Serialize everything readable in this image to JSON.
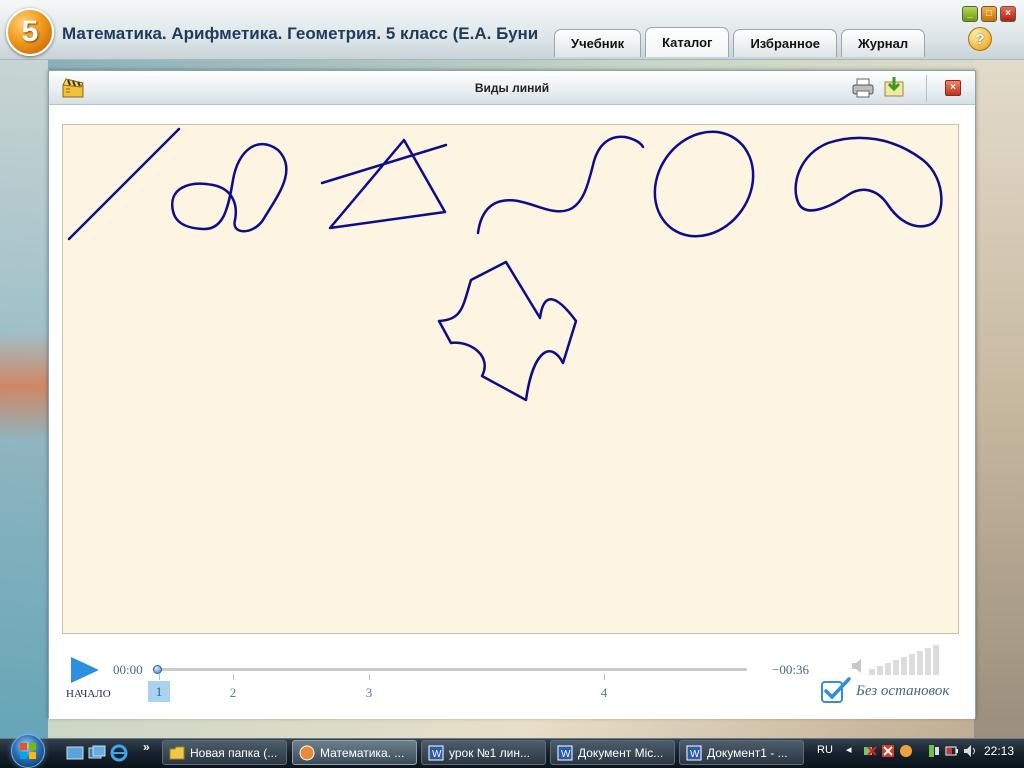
{
  "header": {
    "grade": "5",
    "title": "Математика. Арифметика. Геометрия. 5 класс (Е.А. Буни",
    "tabs": [
      {
        "label": "Учебник",
        "active": false
      },
      {
        "label": "Каталог",
        "active": true
      },
      {
        "label": "Избранное",
        "active": false
      },
      {
        "label": "Журнал",
        "active": false
      }
    ],
    "help": "?"
  },
  "content": {
    "title": "Виды линий"
  },
  "player": {
    "start_label": "НАЧАЛО",
    "time_current": "00:00",
    "time_remaining": "−00:36",
    "progress": 0,
    "markers": [
      "1",
      "2",
      "3",
      "4"
    ],
    "active_marker": "1",
    "nonstop_label": "Без остановок",
    "nonstop_checked": true
  },
  "taskbar": {
    "items": [
      {
        "label": "Новая папка (...",
        "icon": "folder-icon",
        "active": false
      },
      {
        "label": "Математика. ...",
        "icon": "app-icon",
        "active": true
      },
      {
        "label": "урок №1 лин...",
        "icon": "word-icon",
        "active": false
      },
      {
        "label": "Документ Mic...",
        "icon": "word-icon",
        "active": false
      },
      {
        "label": "Документ1 - ...",
        "icon": "word-icon",
        "active": false
      }
    ],
    "language": "RU",
    "clock": "22:13"
  },
  "colors": {
    "line_color": "#0d0d8a",
    "canvas_bg": "#fdf4e1",
    "accent_blue": "#2e8ee0"
  }
}
